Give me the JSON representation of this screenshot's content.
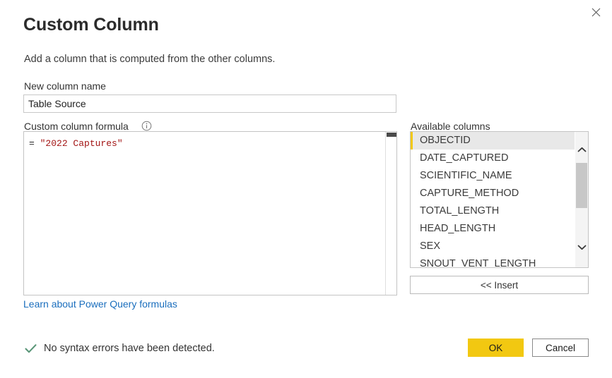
{
  "dialog": {
    "title": "Custom Column",
    "subtitle": "Add a column that is computed from the other columns.",
    "close_icon": "close-icon"
  },
  "new_column_name": {
    "label": "New column name",
    "value": "Table Source",
    "placeholder": ""
  },
  "formula": {
    "label": "Custom column formula",
    "info_icon": "info-icon",
    "prefix": "= ",
    "string_literal": "\"2022 Captures\"",
    "full_text": "= \"2022 Captures\"",
    "string_color": "#a31515"
  },
  "learn_link": {
    "text": "Learn about Power Query formulas",
    "color": "#1a6ebd"
  },
  "available_columns": {
    "label": "Available columns",
    "selected_index": 0,
    "accent_color": "#f2c811",
    "items": [
      "OBJECTID",
      "DATE_CAPTURED",
      "SCIENTIFIC_NAME",
      "CAPTURE_METHOD",
      "TOTAL_LENGTH",
      "HEAD_LENGTH",
      "SEX",
      "SNOUT_VENT_LENGTH"
    ]
  },
  "insert_button": {
    "label": "<< Insert"
  },
  "status": {
    "icon": "checkmark-icon",
    "icon_color": "#5a9678",
    "text": "No syntax errors have been detected."
  },
  "footer": {
    "ok_label": "OK",
    "ok_color": "#f2c811",
    "cancel_label": "Cancel"
  }
}
